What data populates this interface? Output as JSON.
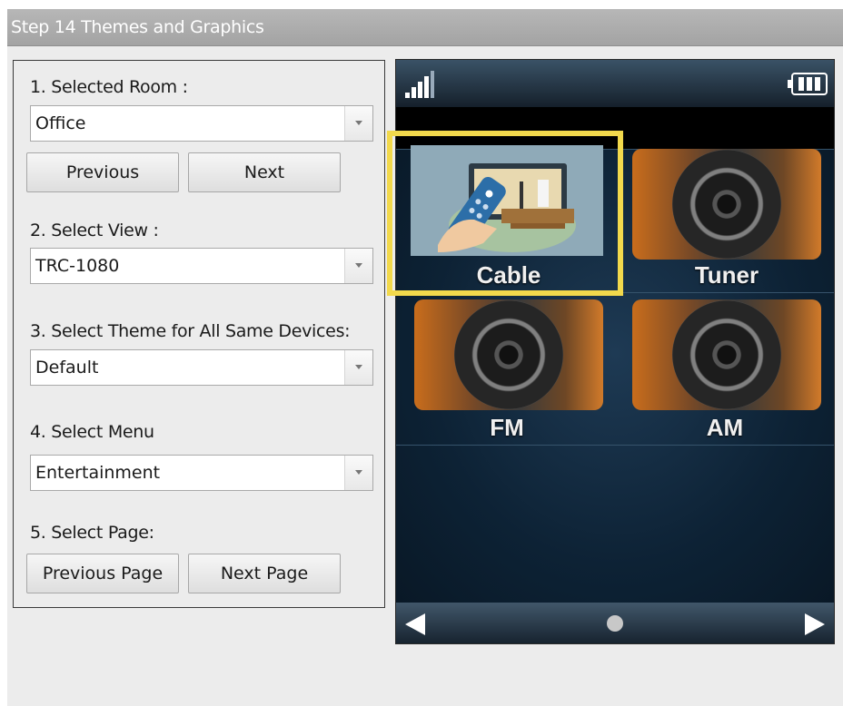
{
  "window": {
    "title": "Step 14 Themes and Graphics"
  },
  "form": {
    "room": {
      "label": "1. Selected Room :",
      "value": "Office"
    },
    "room_nav": {
      "previous": "Previous",
      "next": "Next"
    },
    "view": {
      "label": "2. Select View :",
      "value": "TRC-1080"
    },
    "theme": {
      "label": "3. Select Theme for All Same Devices:",
      "value": "Default"
    },
    "menu": {
      "label": "4. Select Menu",
      "value": "Entertainment"
    },
    "page": {
      "label": "5. Select Page:",
      "previous": "Previous Page",
      "next": "Next Page"
    }
  },
  "preview": {
    "tiles": [
      {
        "label": "Cable",
        "icon": "cable-tv-remote-icon",
        "selected": true
      },
      {
        "label": "Tuner",
        "icon": "speaker-icon",
        "selected": false
      },
      {
        "label": "FM",
        "icon": "speaker-icon",
        "selected": false
      },
      {
        "label": "AM",
        "icon": "speaker-icon",
        "selected": false
      }
    ],
    "status_icons": [
      "signal-strength-icon",
      "battery-icon"
    ],
    "nav_icons": [
      "arrow-left-icon",
      "page-dot-icon",
      "arrow-right-icon"
    ],
    "highlight_color": "#f2d94c"
  }
}
